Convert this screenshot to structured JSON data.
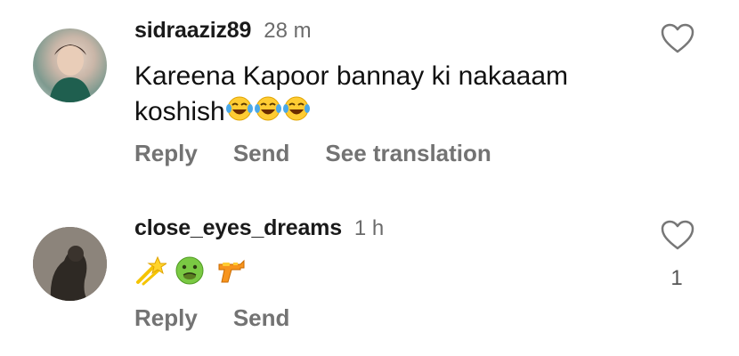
{
  "comments": [
    {
      "username": "sidraaziz89",
      "time": "28 m",
      "text_line1": "Kareena Kapoor bannay ki nakaaam",
      "text_line2": "koshish",
      "emojis": [
        "laughing-tears-emoji",
        "laughing-tears-emoji",
        "laughing-tears-emoji"
      ],
      "actions": [
        "Reply",
        "Send",
        "See translation"
      ],
      "likes": ""
    },
    {
      "username": "close_eyes_dreams",
      "time": "1 h",
      "emojis": [
        "dizzy-star-emoji",
        "nauseated-face-emoji",
        "water-pistol-emoji"
      ],
      "actions": [
        "Reply",
        "Send"
      ],
      "likes": "1"
    }
  ]
}
